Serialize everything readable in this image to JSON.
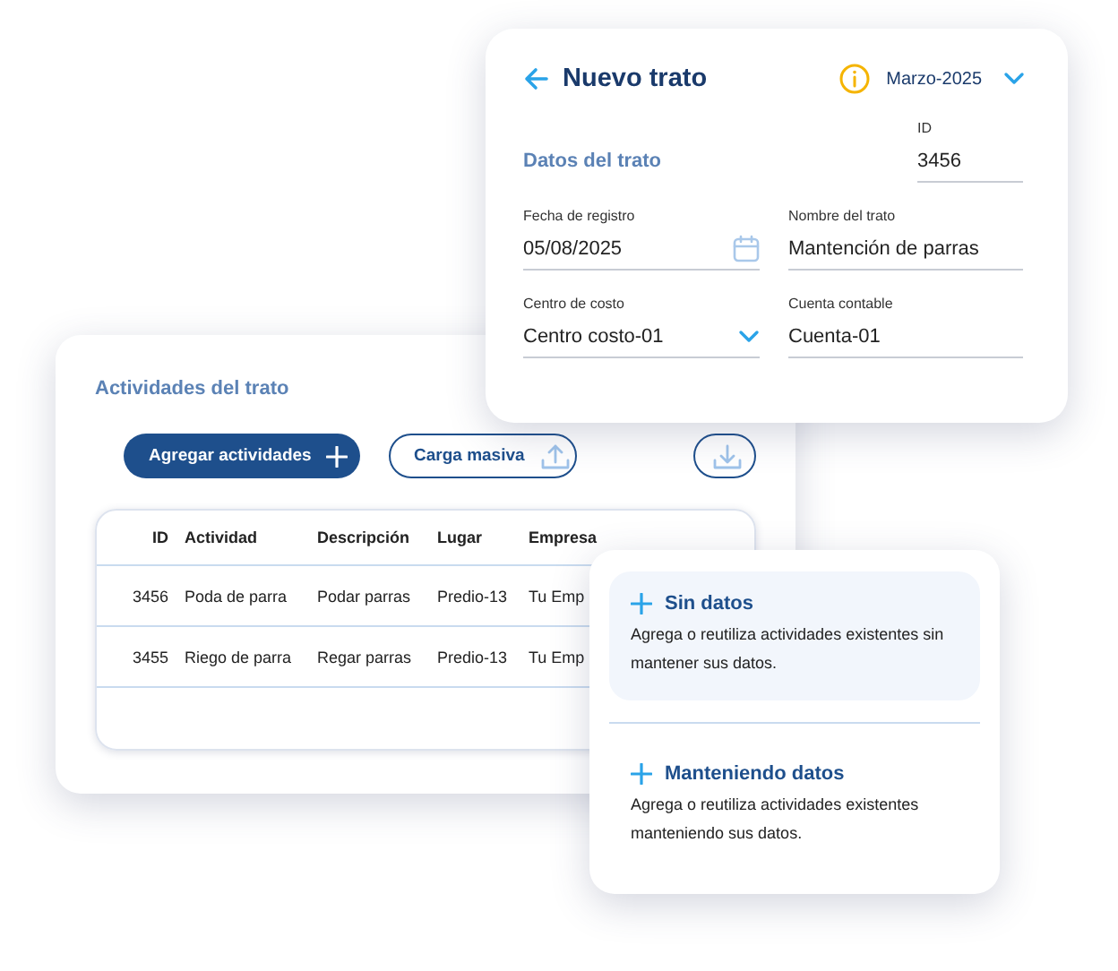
{
  "deal_form": {
    "title": "Nuevo trato",
    "period": "Marzo-2025",
    "section_title": "Datos del trato",
    "fields": [
      {
        "kind": "text",
        "label": "ID",
        "value": "3456"
      },
      {
        "kind": "date",
        "label": "Fecha de registro",
        "value": "05/08/2025"
      },
      {
        "kind": "text",
        "label": "Nombre del trato",
        "value": "Mantención de parras"
      },
      {
        "kind": "select",
        "label": "Centro de costo",
        "value": "Centro costo-01"
      },
      {
        "kind": "text",
        "label": "Cuenta contable",
        "value": "Cuenta-01"
      }
    ]
  },
  "activities": {
    "title": "Actividades del trato",
    "buttons": [
      {
        "kind": "primary",
        "label": "Agregar actividades"
      },
      {
        "kind": "upload",
        "label": "Carga masiva"
      },
      {
        "kind": "download"
      }
    ],
    "table": {
      "columns": [
        "ID",
        "Actividad",
        "Descripción",
        "Lugar",
        "Empresa"
      ],
      "rows": [
        [
          "3456",
          "Poda de parra",
          "Podar parras",
          "Predio-13",
          "Tu Emp"
        ],
        [
          "3455",
          "Riego de parra",
          "Regar parras",
          "Predio-13",
          "Tu Emp"
        ]
      ]
    }
  },
  "add_menu": {
    "items": [
      {
        "title": "Sin datos",
        "description": "Agrega o reutiliza actividades existentes sin mantener sus datos.",
        "selected": true
      },
      {
        "title": "Manteniendo datos",
        "description": "Agrega o reutiliza actividades existentes manteniendo sus datos.",
        "selected": false
      }
    ]
  }
}
